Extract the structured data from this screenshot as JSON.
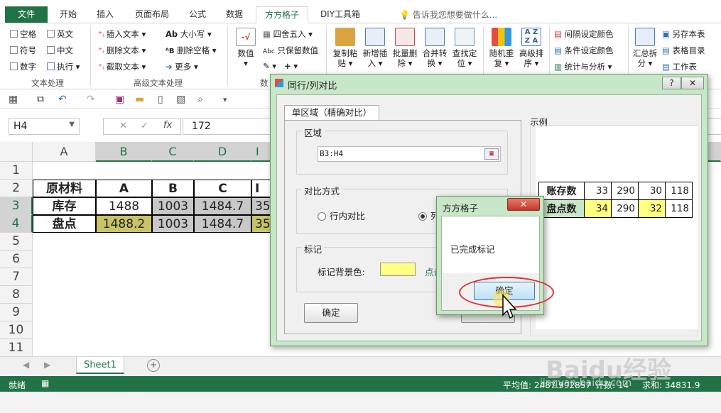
{
  "ribbon_tabs": [
    "文件",
    "开始",
    "插入",
    "页面布局",
    "公式",
    "数据",
    "方方格子",
    "DIY工具箱"
  ],
  "tell_me": "告诉我您想要做什么...",
  "ribbon": {
    "checks": [
      "空格",
      "英文",
      "符号",
      "中文",
      "数字"
    ],
    "exec_label": "执行",
    "group1_label": "文本处理",
    "t2": [
      "插入文本",
      "删除文本",
      "截取文本"
    ],
    "t3": [
      "大小写",
      "删除空格",
      "更多"
    ],
    "group2_label": "高级文本处理",
    "num_btn": "数值",
    "num_items": [
      "四舍五入",
      "只保留数值"
    ],
    "num_group": "数",
    "big_btns": [
      {
        "l1": "复制粘",
        "l2": "贴"
      },
      {
        "l1": "新增插",
        "l2": "入"
      },
      {
        "l1": "批量删",
        "l2": "除"
      },
      {
        "l1": "合并转",
        "l2": "换"
      },
      {
        "l1": "查找定",
        "l2": "位"
      },
      {
        "l1": "随机重",
        "l2": "复"
      },
      {
        "l1": "高级排",
        "l2": "序"
      }
    ],
    "color_items": [
      "间隔设定颜色",
      "条件设定颜色",
      "统计与分析"
    ],
    "summary_btn": {
      "l1": "汇总拆",
      "l2": "分"
    },
    "right_items": [
      "另存本表",
      "表格目录",
      "工作表"
    ]
  },
  "formula_bar": {
    "name_box": "H4",
    "value": "172"
  },
  "grid": {
    "columns": [
      "A",
      "B",
      "C",
      "D",
      "I"
    ],
    "rows": [
      "1",
      "2",
      "3",
      "4",
      "5",
      "6",
      "7",
      "8",
      "9",
      "10",
      "11"
    ],
    "header_row": [
      "原材料",
      "A",
      "B",
      "C",
      "I"
    ],
    "stock_row": [
      "库存",
      "1488",
      "1003",
      "1484.7",
      "35"
    ],
    "count_row": [
      "盘点",
      "1488.2",
      "1003",
      "1484.7",
      "35"
    ]
  },
  "sheet_tab": "Sheet1",
  "status": {
    "ready": "就绪",
    "average": "平均值: 2487.992857",
    "count": "计数: 14",
    "sum": "求和: 34831.9"
  },
  "dialog": {
    "title": "同行/列对比",
    "tab": "单区域（精确对比）",
    "region_label": "区域",
    "region_value": "B3:H4",
    "compare_label": "对比方式",
    "radio1": "行内对比",
    "radio2": "列",
    "mark_label": "标记",
    "mark_color_label": "标记背景色:",
    "mark_color": "#ffff80",
    "click_hint": "点击",
    "ok": "确定",
    "example_label": "示例",
    "example": {
      "rows": [
        {
          "label": "账存数",
          "values": [
            "33",
            "290",
            "30",
            "118"
          ]
        },
        {
          "label": "盘点数",
          "values": [
            "34",
            "290",
            "32",
            "118"
          ]
        }
      ]
    }
  },
  "msgbox": {
    "title": "方方格子",
    "text": "已完成标记",
    "ok": "确定"
  },
  "watermark": {
    "main": "Baidu经验",
    "sub": "jingyan.baidu.com"
  }
}
